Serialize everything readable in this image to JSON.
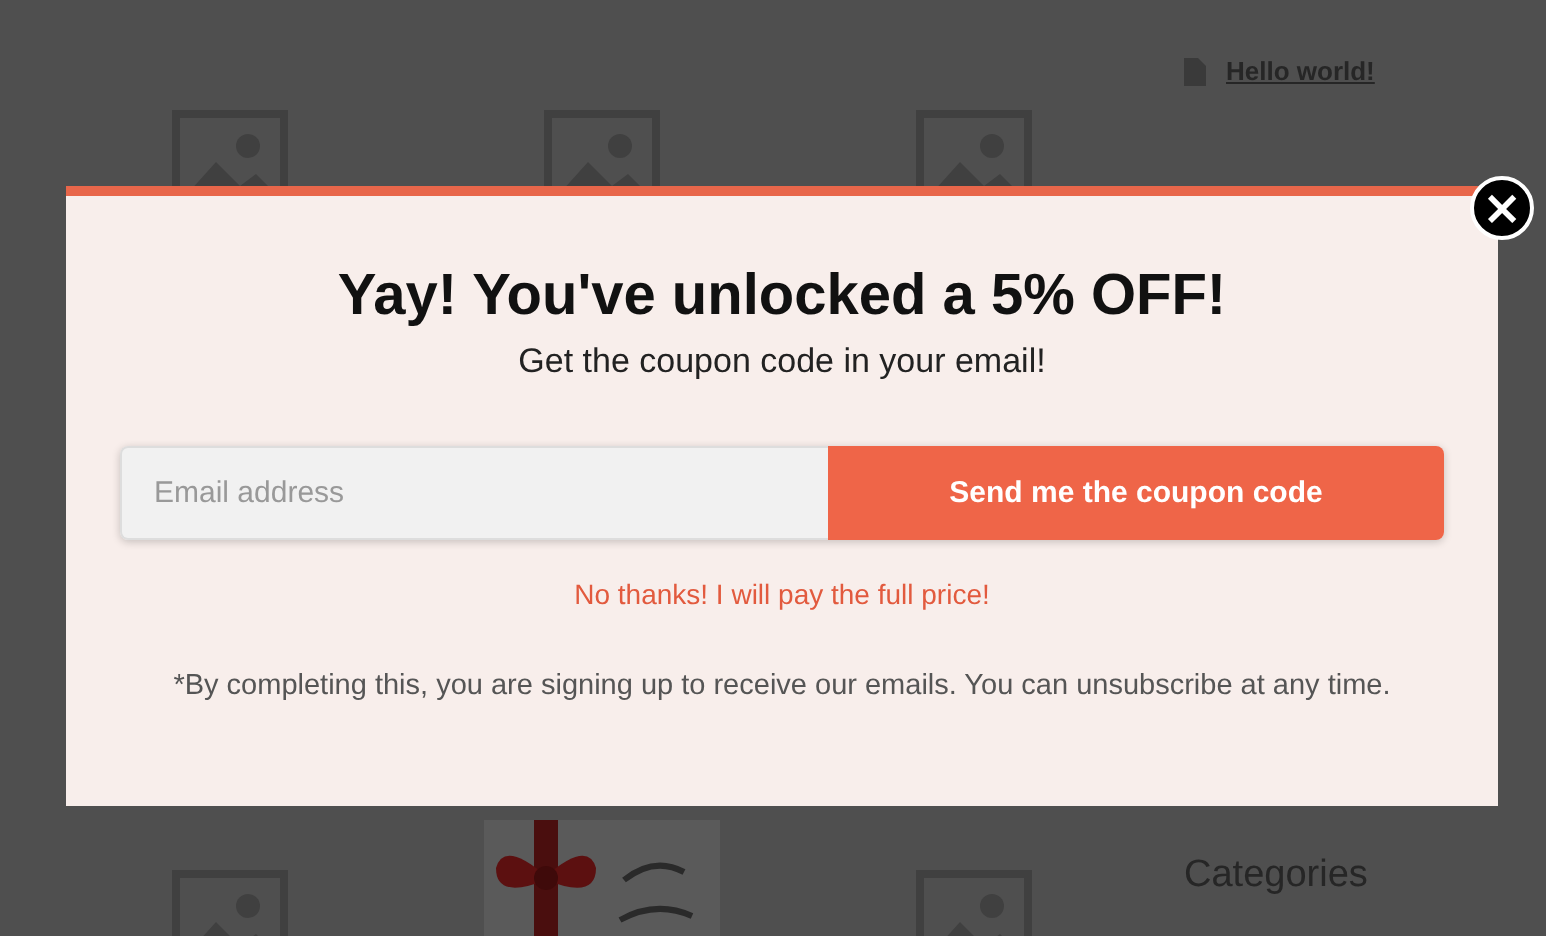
{
  "page": {
    "sidebar_link": "Hello world!",
    "sidebar_heading": "Categories",
    "products": [
      {
        "kind": "placeholder"
      },
      {
        "kind": "placeholder"
      },
      {
        "kind": "placeholder"
      },
      {
        "kind": "placeholder"
      },
      {
        "kind": "picture"
      },
      {
        "kind": "placeholder"
      }
    ]
  },
  "popup": {
    "close": "×",
    "title": "Yay! You've unlocked a 5% OFF!",
    "subtitle": "Get the coupon code in your email!",
    "email": {
      "placeholder": "Email address"
    },
    "submit": "Send me the coupon code",
    "decline": "No thanks! I will pay the full price!",
    "disclaimer": "*By completing this, you are signing up to receive our emails. You can unsubscribe at any time."
  }
}
